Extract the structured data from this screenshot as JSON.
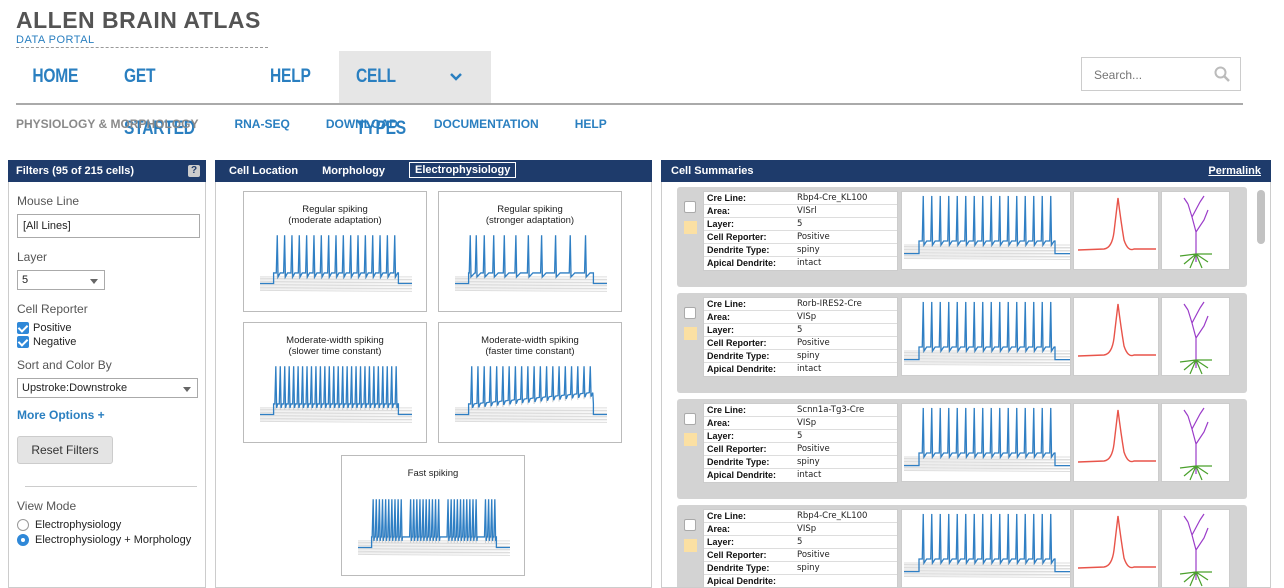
{
  "brand": {
    "title": "ALLEN BRAIN ATLAS",
    "subtitle": "DATA PORTAL"
  },
  "main_nav": {
    "items": [
      "HOME",
      "GET STARTED",
      "HELP",
      "CELL TYPES"
    ],
    "active": "CELL TYPES"
  },
  "search": {
    "placeholder": "Search..."
  },
  "sub_nav": {
    "items": [
      "PHYSIOLOGY & MORPHOLOGY",
      "RNA-SEQ",
      "DOWNLOAD",
      "DOCUMENTATION",
      "HELP"
    ],
    "active": "PHYSIOLOGY & MORPHOLOGY"
  },
  "filters": {
    "header": "Filters (95 of 215 cells)",
    "help_glyph": "?",
    "mouse_line": {
      "label": "Mouse Line",
      "value": "[All Lines]"
    },
    "layer": {
      "label": "Layer",
      "value": "5"
    },
    "cell_reporter": {
      "label": "Cell Reporter",
      "options": [
        "Positive",
        "Negative"
      ],
      "checked": [
        true,
        true
      ]
    },
    "sort": {
      "label": "Sort and Color By",
      "value": "Upstroke:Downstroke"
    },
    "more_options": "More Options +",
    "reset": "Reset Filters",
    "view_mode": {
      "label": "View Mode",
      "options": [
        "Electrophysiology",
        "Electrophysiology + Morphology"
      ],
      "selected": "Electrophysiology + Morphology"
    }
  },
  "middle": {
    "tabs": [
      "Cell Location",
      "Morphology",
      "Electrophysiology"
    ],
    "active_tab": "Electrophysiology",
    "cards": [
      {
        "line1": "Regular spiking",
        "line2": "(moderate adaptation)"
      },
      {
        "line1": "Regular spiking",
        "line2": "(stronger adaptation)"
      },
      {
        "line1": "Moderate-width spiking",
        "line2": "(slower time constant)"
      },
      {
        "line1": "Moderate-width spiking",
        "line2": "(faster time constant)"
      },
      {
        "line1": "Fast spiking",
        "line2": ""
      }
    ],
    "trace_color": "#2f7fc4"
  },
  "summaries": {
    "header": "Cell Summaries",
    "permalink": "Permalink",
    "field_labels": [
      "Cre Line:",
      "Area:",
      "Layer:",
      "Cell Reporter:",
      "Dendrite Type:",
      "Apical Dendrite:"
    ],
    "cells": [
      {
        "cre": "Rbp4-Cre_KL100",
        "area": "VISrl",
        "layer": "5",
        "reporter": "Positive",
        "dendrite": "spiny",
        "apical": "intact"
      },
      {
        "cre": "Rorb-IRES2-Cre",
        "area": "VISp",
        "layer": "5",
        "reporter": "Positive",
        "dendrite": "spiny",
        "apical": "intact"
      },
      {
        "cre": "Scnn1a-Tg3-Cre",
        "area": "VISp",
        "layer": "5",
        "reporter": "Positive",
        "dendrite": "spiny",
        "apical": "intact"
      },
      {
        "cre": "Rbp4-Cre_KL100",
        "area": "VISp",
        "layer": "5",
        "reporter": "Positive",
        "dendrite": "spiny",
        "apical": ""
      }
    ],
    "swatch_color": "#fbe0a3",
    "ap_color": "#e8544a",
    "axon_color": "#9b3cc9",
    "dendrite_color": "#4aa02c"
  }
}
